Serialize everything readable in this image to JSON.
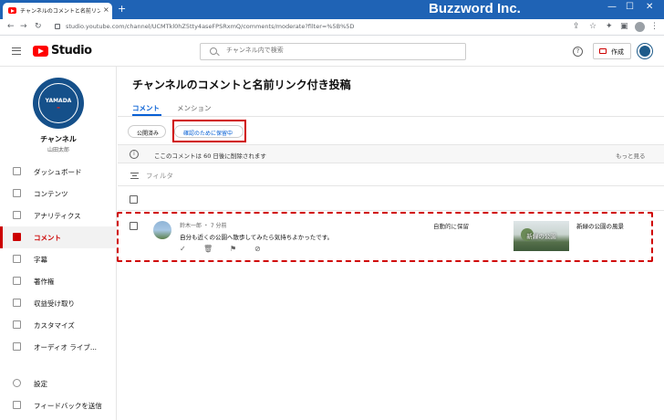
{
  "browser": {
    "tab_title": "チャンネルのコメントと名前リンク付き",
    "url": "studio.youtube.com/channel/UCMTkl0hZ5tty4aseFPSRxmQ/comments/moderate?filter=%5B%5D",
    "brand_watermark": "Buzzword Inc.",
    "new_tab": "+",
    "tab_close": "×"
  },
  "header": {
    "logo_text": "Studio",
    "search_placeholder": "チャンネル内で検索",
    "help": "?",
    "create_label": "作成"
  },
  "sidebar": {
    "channel_avatar_text": "YAMADA",
    "channel_name": "チャンネル",
    "channel_user": "山田太郎",
    "items": [
      {
        "label": "ダッシュボード",
        "icon": "dashboard-icon"
      },
      {
        "label": "コンテンツ",
        "icon": "content-icon"
      },
      {
        "label": "アナリティクス",
        "icon": "analytics-icon"
      },
      {
        "label": "コメント",
        "icon": "comment-icon",
        "active": true
      },
      {
        "label": "字幕",
        "icon": "subtitles-icon"
      },
      {
        "label": "著作権",
        "icon": "copyright-icon"
      },
      {
        "label": "収益受け取り",
        "icon": "monetization-icon"
      },
      {
        "label": "カスタマイズ",
        "icon": "customize-icon"
      },
      {
        "label": "オーディオ ライブ...",
        "icon": "audio-library-icon"
      }
    ],
    "footer_items": [
      {
        "label": "設定",
        "icon": "settings-icon"
      },
      {
        "label": "フィードバックを送信",
        "icon": "feedback-icon"
      }
    ]
  },
  "main": {
    "page_title": "チャンネルのコメントと名前リンク付き投稿",
    "tabs": [
      {
        "label": "コメント",
        "active": true
      },
      {
        "label": "メンション",
        "active": false
      }
    ],
    "chips": [
      {
        "label": "公開済み",
        "active": false
      },
      {
        "label": "確認のために保留中",
        "active": true
      }
    ],
    "info_text": "ここのコメントは 60 日後に削除されます",
    "more_link": "もっと見る",
    "filter_placeholder": "フィルタ",
    "comments": [
      {
        "author_meta": "鈴木一郎 ・ 7 分前",
        "text": "自分も近くの公園へ散歩してみたら気持ちよかったです。",
        "status": "自動的に保留",
        "thumbnail_caption": "新緑の公園",
        "video_title": "新緑の公園の風景"
      }
    ]
  },
  "colors": {
    "accent_blue": "#065fd4",
    "youtube_red": "#ff0000",
    "highlight_red": "#d00000",
    "browser_bar": "#1f63b5"
  }
}
